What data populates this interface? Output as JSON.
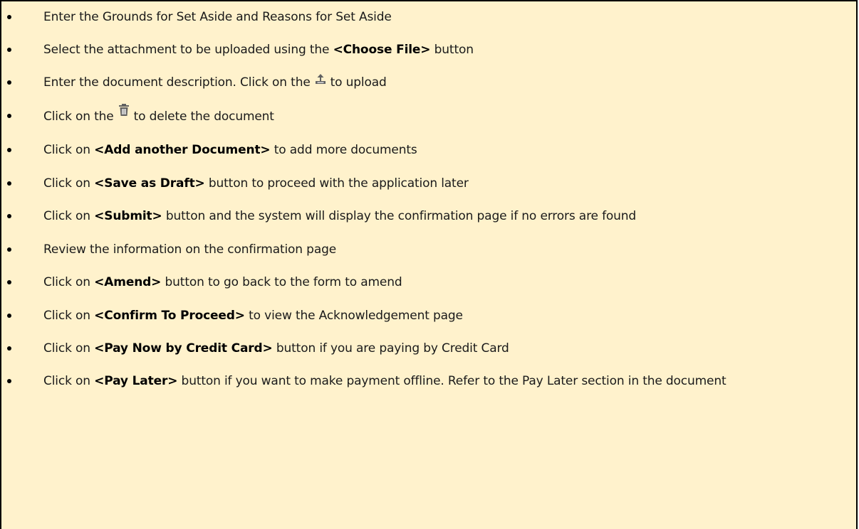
{
  "steps": [
    {
      "pre": "Enter the Grounds for Set Aside and Reasons for Set Aside",
      "bold": "",
      "post": ""
    },
    {
      "pre": "Select the attachment to be uploaded using the ",
      "bold": "<Choose File>",
      "post": " button"
    },
    {
      "pre": "Enter the document description. Click on the",
      "icon": "upload-icon",
      "post": "to upload"
    },
    {
      "pre": "Click on the",
      "icon": "trash-icon",
      "post": "to delete the document"
    },
    {
      "pre": "Click on ",
      "bold": "<Add another Document>",
      "post": " to add more documents"
    },
    {
      "pre": "Click on ",
      "bold": "<Save as Draft>",
      "post": " button to proceed with the application later"
    },
    {
      "pre": "Click on ",
      "bold": "<Submit>",
      "post": " button and the system will display the confirmation page if no errors are found"
    },
    {
      "pre": "Review the information on the confirmation page",
      "bold": "",
      "post": ""
    },
    {
      "pre": "Click on ",
      "bold": "<Amend>",
      "post": " button to go back to the form to amend"
    },
    {
      "pre": "Click on ",
      "bold": "<Confirm To Proceed>",
      "post": " to view the Acknowledgement page"
    },
    {
      "pre": "Click on ",
      "bold": "<Pay Now by Credit Card>",
      "post": " button if you are paying by Credit Card"
    },
    {
      "pre": "Click on ",
      "bold": "<Pay Later>",
      "post": " button if you want to make payment offline.  Refer to the Pay Later section in the document"
    }
  ],
  "colors": {
    "background": "#fff2cc",
    "text": "#1a1a1a",
    "icon": "#616161"
  }
}
